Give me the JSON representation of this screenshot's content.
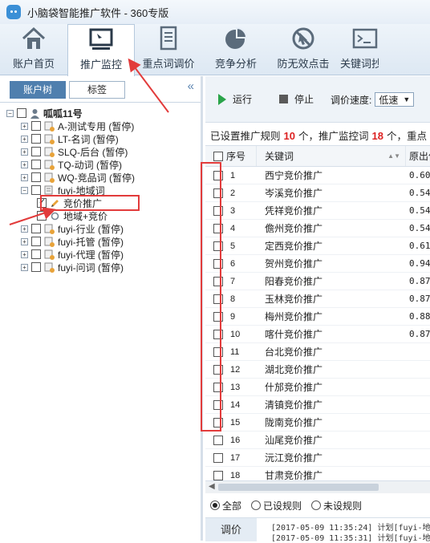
{
  "window": {
    "title": "小脑袋智能推广软件 - 360专版"
  },
  "nav": {
    "tabs": [
      {
        "label": "账户首页",
        "icon": "home-icon"
      },
      {
        "label": "推广监控",
        "icon": "monitor-icon",
        "active": true
      },
      {
        "label": "重点词调价",
        "icon": "document-icon"
      },
      {
        "label": "竞争分析",
        "icon": "pie-chart-icon"
      },
      {
        "label": "防无效点击",
        "icon": "no-click-icon"
      },
      {
        "label": "关键词抄",
        "icon": "terminal-icon"
      }
    ]
  },
  "left": {
    "tabs": [
      {
        "label": "账户树",
        "active": true
      },
      {
        "label": "标签"
      }
    ],
    "collapse": "«",
    "root": "呱呱11号",
    "nodes": [
      {
        "label": "A-测试专用 (暂停)"
      },
      {
        "label": "LT-名词 (暂停)"
      },
      {
        "label": "SLQ-后台 (暂停)"
      },
      {
        "label": "TQ-动词 (暂停)"
      },
      {
        "label": "WQ-竞品词 (暂停)"
      },
      {
        "label": "fuyi-地域词"
      },
      {
        "label": "竞价推广"
      },
      {
        "label": "地域+竞价"
      },
      {
        "label": "fuyi-行业 (暂停)"
      },
      {
        "label": "fuyi-托管 (暂停)"
      },
      {
        "label": "fuyi-代理 (暂停)"
      },
      {
        "label": "fuyi-问词 (暂停)"
      }
    ]
  },
  "toolbar": {
    "run": "运行",
    "stop": "停止",
    "speed_label": "调价速度:",
    "speed_value": "低速"
  },
  "summary": {
    "prefix": "已设置推广规则",
    "rules": "10",
    "mid": "个，推广监控词",
    "words": "18",
    "suffix": "个，重点"
  },
  "grid": {
    "headers": {
      "seq": "序号",
      "keyword": "关键词",
      "bid": "原出价"
    },
    "rows": [
      {
        "seq": "1",
        "keyword": "西宁竞价推广",
        "bid": "0.60"
      },
      {
        "seq": "2",
        "keyword": "岑溪竞价推广",
        "bid": "0.54"
      },
      {
        "seq": "3",
        "keyword": "凭祥竞价推广",
        "bid": "0.54"
      },
      {
        "seq": "4",
        "keyword": "儋州竞价推广",
        "bid": "0.54"
      },
      {
        "seq": "5",
        "keyword": "定西竞价推广",
        "bid": "0.61"
      },
      {
        "seq": "6",
        "keyword": "贺州竞价推广",
        "bid": "0.94"
      },
      {
        "seq": "7",
        "keyword": "阳春竞价推广",
        "bid": "0.87"
      },
      {
        "seq": "8",
        "keyword": "玉林竞价推广",
        "bid": "0.87"
      },
      {
        "seq": "9",
        "keyword": "梅州竞价推广",
        "bid": "0.88"
      },
      {
        "seq": "10",
        "keyword": "喀什竞价推广",
        "bid": "0.87"
      },
      {
        "seq": "11",
        "keyword": "台北竞价推广",
        "bid": ""
      },
      {
        "seq": "12",
        "keyword": "湖北竞价推广",
        "bid": ""
      },
      {
        "seq": "13",
        "keyword": "什邡竞价推广",
        "bid": ""
      },
      {
        "seq": "14",
        "keyword": "清镇竞价推广",
        "bid": ""
      },
      {
        "seq": "15",
        "keyword": "陇南竞价推广",
        "bid": ""
      },
      {
        "seq": "16",
        "keyword": "汕尾竞价推广",
        "bid": ""
      },
      {
        "seq": "17",
        "keyword": "沅江竞价推广",
        "bid": ""
      },
      {
        "seq": "18",
        "keyword": "甘肃竞价推广",
        "bid": ""
      }
    ]
  },
  "filter": {
    "all": "全部",
    "set": "已设规则",
    "unset": "未设规则"
  },
  "log": {
    "tab": "调价",
    "lines": [
      "[2017-05-09 11:35:24] 计划[fuyi-地",
      "[2017-05-09 11:35:31] 计划[fuyi-地"
    ]
  },
  "colors": {
    "annotation": "#e23b3b",
    "accent": "#4f7fae",
    "count": "#dd2222",
    "run": "#2aa44a"
  }
}
